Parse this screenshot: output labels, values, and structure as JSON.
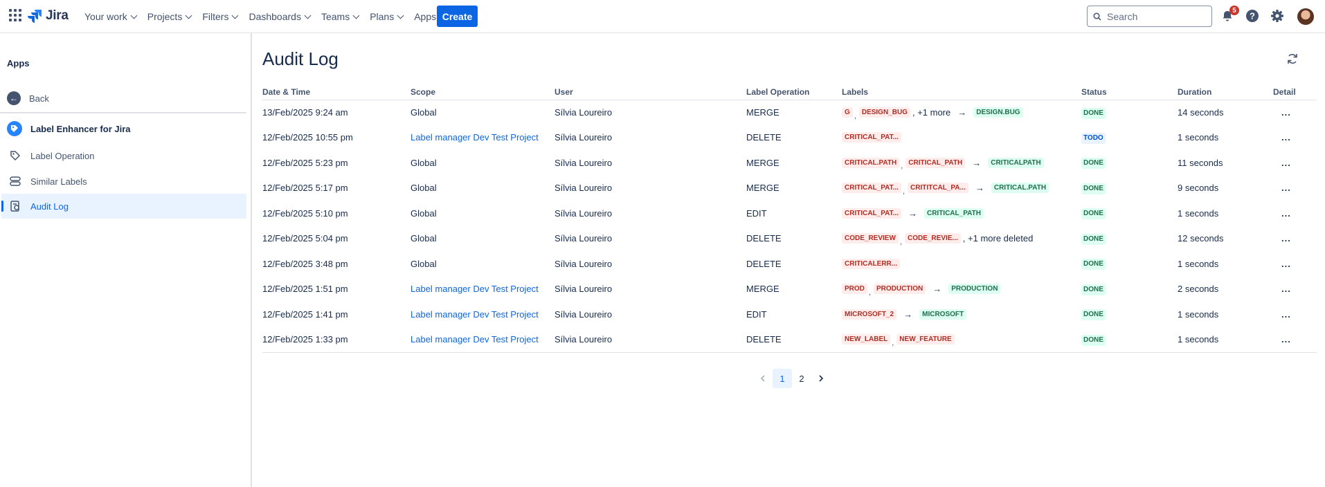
{
  "topnav": {
    "logo_text": "Jira",
    "menu": [
      {
        "label": "Your work"
      },
      {
        "label": "Projects"
      },
      {
        "label": "Filters"
      },
      {
        "label": "Dashboards"
      },
      {
        "label": "Teams"
      },
      {
        "label": "Plans"
      },
      {
        "label": "Apps"
      }
    ],
    "create_label": "Create",
    "search_placeholder": "Search",
    "notifications_count": "5",
    "accent_color": "#0c66e4"
  },
  "sidebar": {
    "section_title": "Apps",
    "back_label": "Back",
    "app_name": "Label Enhancer for Jira",
    "items": [
      {
        "label": "Label Operation",
        "icon": "label-operation-icon"
      },
      {
        "label": "Similar Labels",
        "icon": "similar-labels-icon"
      },
      {
        "label": "Audit Log",
        "icon": "audit-log-icon",
        "active": true
      }
    ]
  },
  "main": {
    "title": "Audit Log",
    "columns": [
      "Date & Time",
      "Scope",
      "User",
      "Label Operation",
      "Labels",
      "Status",
      "Duration",
      "Detail"
    ],
    "rows": [
      {
        "date": "13/Feb/2025 9:24 am",
        "scope": "Global",
        "scope_link": false,
        "user": "Sílvia Loureiro",
        "op": "MERGE",
        "labels": {
          "from": [
            "G",
            "DESIGN_BUG"
          ],
          "more": ", +1 more",
          "to": [
            "DESIGN.BUG"
          ]
        },
        "status": "DONE",
        "duration": "14 seconds"
      },
      {
        "date": "12/Feb/2025 10:55 pm",
        "scope": "Label manager Dev Test Project",
        "scope_link": true,
        "user": "Sílvia Loureiro",
        "op": "DELETE",
        "labels": {
          "from": [
            "CRITICAL_PAT..."
          ],
          "more": "",
          "to": []
        },
        "status": "TODO",
        "duration": "1 seconds"
      },
      {
        "date": "12/Feb/2025 5:23 pm",
        "scope": "Global",
        "scope_link": false,
        "user": "Sílvia Loureiro",
        "op": "MERGE",
        "labels": {
          "from": [
            "CRITICAL.PATH",
            "CRITICAL_PATH"
          ],
          "more": "",
          "to": [
            "CRITICALPATH"
          ]
        },
        "status": "DONE",
        "duration": "11 seconds"
      },
      {
        "date": "12/Feb/2025 5:17 pm",
        "scope": "Global",
        "scope_link": false,
        "user": "Sílvia Loureiro",
        "op": "MERGE",
        "labels": {
          "from": [
            "CRITICAL_PAT...",
            "CRITITCAL_PA..."
          ],
          "more": "",
          "to": [
            "CRITICAL.PATH"
          ]
        },
        "status": "DONE",
        "duration": "9 seconds"
      },
      {
        "date": "12/Feb/2025 5:10 pm",
        "scope": "Global",
        "scope_link": false,
        "user": "Sílvia Loureiro",
        "op": "EDIT",
        "labels": {
          "from": [
            "CRITICAL_PAT..."
          ],
          "more": "",
          "to": [
            "CRITICAL_PATH"
          ]
        },
        "status": "DONE",
        "duration": "1 seconds"
      },
      {
        "date": "12/Feb/2025 5:04 pm",
        "scope": "Global",
        "scope_link": false,
        "user": "Sílvia Loureiro",
        "op": "DELETE",
        "labels": {
          "from": [
            "CODE_REVIEW",
            "CODE_REVIE..."
          ],
          "more": ", +1 more deleted",
          "to": []
        },
        "status": "DONE",
        "duration": "12 seconds"
      },
      {
        "date": "12/Feb/2025 3:48 pm",
        "scope": "Global",
        "scope_link": false,
        "user": "Sílvia Loureiro",
        "op": "DELETE",
        "labels": {
          "from": [
            "CRITICALERR..."
          ],
          "more": "",
          "to": []
        },
        "status": "DONE",
        "duration": "1 seconds"
      },
      {
        "date": "12/Feb/2025 1:51 pm",
        "scope": "Label manager Dev Test Project",
        "scope_link": true,
        "user": "Sílvia Loureiro",
        "op": "MERGE",
        "labels": {
          "from": [
            "PROD",
            "PRODUCTION"
          ],
          "more": "",
          "to": [
            "PRODUCTION"
          ]
        },
        "status": "DONE",
        "duration": "2 seconds"
      },
      {
        "date": "12/Feb/2025 1:41 pm",
        "scope": "Label manager Dev Test Project",
        "scope_link": true,
        "user": "Sílvia Loureiro",
        "op": "EDIT",
        "labels": {
          "from": [
            "MICROSOFT_2"
          ],
          "more": "",
          "to": [
            "MICROSOFT"
          ]
        },
        "status": "DONE",
        "duration": "1 seconds"
      },
      {
        "date": "12/Feb/2025 1:33 pm",
        "scope": "Label manager Dev Test Project",
        "scope_link": true,
        "user": "Sílvia Loureiro",
        "op": "DELETE",
        "labels": {
          "from": [
            "NEW_LABEL",
            "NEW_FEATURE"
          ],
          "more": "",
          "to": []
        },
        "status": "DONE",
        "duration": "1 seconds"
      }
    ],
    "detail_label": "...",
    "arrow": "→",
    "pagination": {
      "pages": [
        "1",
        "2"
      ],
      "current": "1"
    }
  }
}
